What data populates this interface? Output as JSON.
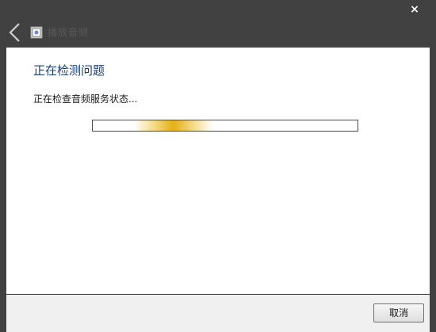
{
  "window": {
    "close_glyph": "×",
    "back_icon": "chevron-left-icon",
    "app_icon": "audio-troubleshooter-icon",
    "title": "播放音频"
  },
  "main": {
    "heading": "正在检测问题",
    "status": "正在检查音频服务状态..."
  },
  "progress": {
    "type": "indeterminate"
  },
  "footer": {
    "cancel_label": "取消"
  },
  "colors": {
    "frame": "#414141",
    "heading": "#1e3f7a",
    "progress_accent": "#e4b014"
  }
}
